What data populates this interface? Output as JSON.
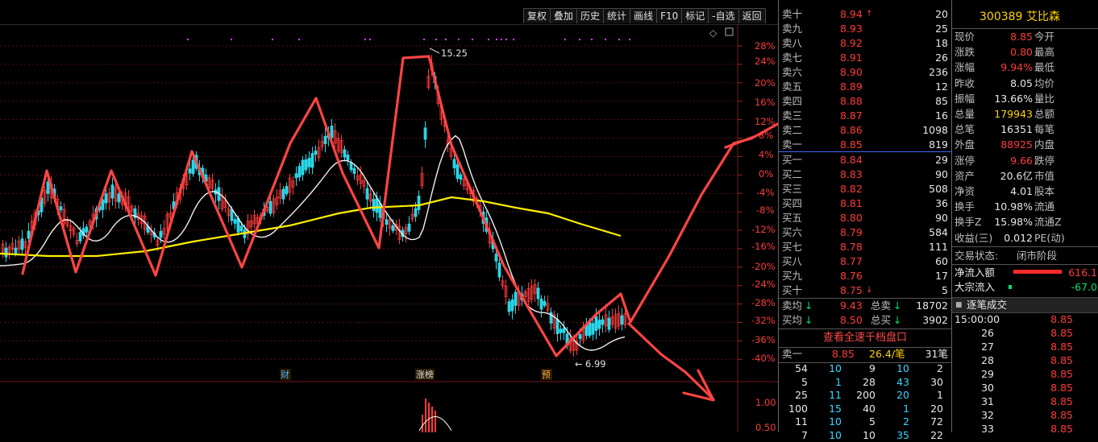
{
  "toolbar": {
    "buttons": [
      "复权",
      "叠加",
      "历史",
      "统计",
      "画线",
      "F10",
      "标记",
      "-自选",
      "返回"
    ]
  },
  "chart": {
    "y_labels": [
      "28%",
      "24%",
      "20%",
      "16%",
      "12%",
      "8%",
      "4%",
      "0%",
      "-4%",
      "-8%",
      "-12%",
      "-16%",
      "-20%",
      "-24%",
      "-28%",
      "-32%",
      "-36%",
      "-40%"
    ],
    "volume_labels": [
      "1.00",
      "0.50"
    ],
    "high_label": "15.25",
    "low_label": "6.99",
    "markers": [
      "财",
      "涨榜",
      "预"
    ]
  },
  "quote": {
    "code": "300389",
    "name": "艾比森",
    "asks": [
      {
        "label": "卖十",
        "price": "8.94",
        "vol": "20",
        "arrow": "↑"
      },
      {
        "label": "卖九",
        "price": "8.93",
        "vol": "25"
      },
      {
        "label": "卖八",
        "price": "8.92",
        "vol": "18"
      },
      {
        "label": "卖七",
        "price": "8.91",
        "vol": "26"
      },
      {
        "label": "卖六",
        "price": "8.90",
        "vol": "236"
      },
      {
        "label": "卖五",
        "price": "8.89",
        "vol": "12"
      },
      {
        "label": "卖四",
        "price": "8.88",
        "vol": "85"
      },
      {
        "label": "卖三",
        "price": "8.87",
        "vol": "16"
      },
      {
        "label": "卖二",
        "price": "8.86",
        "vol": "1098"
      },
      {
        "label": "卖一",
        "price": "8.85",
        "vol": "819"
      }
    ],
    "bids": [
      {
        "label": "买一",
        "price": "8.84",
        "vol": "29"
      },
      {
        "label": "买二",
        "price": "8.83",
        "vol": "90"
      },
      {
        "label": "买三",
        "price": "8.82",
        "vol": "508"
      },
      {
        "label": "买四",
        "price": "8.81",
        "vol": "36"
      },
      {
        "label": "买五",
        "price": "8.80",
        "vol": "90"
      },
      {
        "label": "买六",
        "price": "8.79",
        "vol": "584"
      },
      {
        "label": "买七",
        "price": "8.78",
        "vol": "111"
      },
      {
        "label": "买八",
        "price": "8.77",
        "vol": "60"
      },
      {
        "label": "买九",
        "price": "8.76",
        "vol": "17"
      },
      {
        "label": "买十",
        "price": "8.75",
        "vol": "5",
        "arrow": "↓"
      }
    ],
    "avg_ask": {
      "label": "卖均",
      "price": "9.43",
      "total_label": "总卖",
      "total": "18702"
    },
    "avg_bid": {
      "label": "买均",
      "price": "8.50",
      "total_label": "总买",
      "total": "3902"
    },
    "full_depth_button": "查看全速千档盘口",
    "sell1": {
      "label": "卖一",
      "price": "8.85",
      "size": "26.4/笔",
      "count": "31笔"
    },
    "order_queue": [
      [
        "54",
        "10",
        "9",
        "10",
        "2"
      ],
      [
        "5",
        "1",
        "28",
        "43",
        "30"
      ],
      [
        "25",
        "11",
        "200",
        "20",
        "1"
      ],
      [
        "100",
        "15",
        "40",
        "1",
        "20"
      ],
      [
        "11",
        "10",
        "5",
        "2",
        "72"
      ],
      [
        "7",
        "10",
        "10",
        "35",
        "22"
      ]
    ]
  },
  "stats": {
    "rows": [
      {
        "l1": "现价",
        "v1": "8.85",
        "l2": "今开"
      },
      {
        "l1": "涨跌",
        "v1": "0.80",
        "l2": "最高"
      },
      {
        "l1": "涨幅",
        "v1": "9.94%",
        "l2": "最低"
      },
      {
        "l1": "昨收",
        "v1": "8.05",
        "l2": "均价"
      },
      {
        "l1": "振幅",
        "v1": "13.66%",
        "l2": "量比"
      },
      {
        "l1": "总量",
        "v1": "179943",
        "l2": "总额"
      },
      {
        "l1": "总笔",
        "v1": "16351",
        "l2": "每笔"
      },
      {
        "l1": "外盘",
        "v1": "88925",
        "l2": "内盘"
      },
      {
        "l1": "涨停",
        "v1": "9.66",
        "l2": "跌停"
      },
      {
        "l1": "资产",
        "v1": "20.6亿",
        "l2": "市值"
      },
      {
        "l1": "净资",
        "v1": "4.01",
        "l2": "股本"
      },
      {
        "l1": "换手",
        "v1": "10.98%",
        "l2": "流通"
      },
      {
        "l1": "换手Z",
        "v1": "15.98%",
        "l2": "流通Z"
      },
      {
        "l1": "收益(三)",
        "v1": "0.012",
        "l2": "PE(动)"
      }
    ],
    "trade_status_label": "交易状态:",
    "trade_status": "闭市阶段",
    "net_inflow_label": "净流入额",
    "net_inflow": "616.1",
    "block_inflow_label": "大宗流入",
    "block_inflow": "-67.0",
    "tick_title": "逐笔成交",
    "ticks": [
      {
        "time": "15:00:00",
        "price": "8.85"
      },
      {
        "time": "26",
        "price": "8.85"
      },
      {
        "time": "27",
        "price": "8.85"
      },
      {
        "time": "28",
        "price": "8.85"
      },
      {
        "time": "29",
        "price": "8.85"
      },
      {
        "time": "30",
        "price": "8.85"
      },
      {
        "time": "31",
        "price": "8.85"
      },
      {
        "time": "32",
        "price": "8.85"
      },
      {
        "time": "33",
        "price": "8.85"
      }
    ]
  }
}
